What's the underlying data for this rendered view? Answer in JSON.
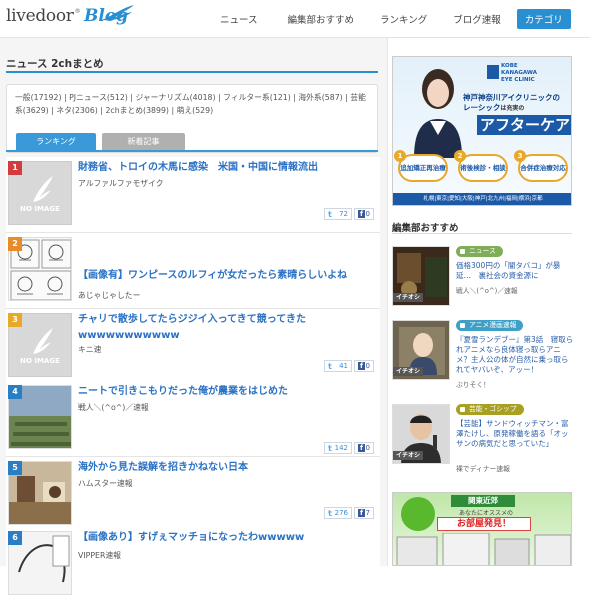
{
  "header": {
    "logo_text": "livedoor",
    "logo_reg": "®",
    "logo_blog": "Blog",
    "nav": [
      "ニュース",
      "編集部おすすめ",
      "ランキング",
      "ブログ速報"
    ],
    "category_button": "カテゴリ"
  },
  "main": {
    "section_title": "ニュース 2chまとめ",
    "categories": [
      "一般(17192)",
      "PJニュース(512)",
      "ジャーナリズム(4018)",
      "フィルター系(121)",
      "海外系(587)",
      "芸能系(3629)",
      "ネタ(2306)",
      "2chまとめ(3899)",
      "萌え(529)"
    ],
    "tabs": {
      "ranking": "ランキング",
      "latest": "新着記事"
    },
    "no_image": "NO IMAGE",
    "articles": [
      {
        "rank": "1",
        "title": "財務省、トロイの木馬に感染　米国・中国に情報流出",
        "blog": "アルファルファモザイク",
        "tweets": "72",
        "likes": "0"
      },
      {
        "rank": "2",
        "title": "【画像有】ワンピースのルフィが女だったら素晴らしいよね",
        "blog": "あじゃじゃしたー",
        "tweets": "33",
        "likes": "0"
      },
      {
        "rank": "3",
        "title": "チャリで散歩してたらジジイ入ってきて競ってきたwwwwwwwwwww",
        "blog": "キニ速",
        "tweets": "41",
        "likes": "0"
      },
      {
        "rank": "4",
        "title": "ニートで引きこもりだった俺が農業をはじめた",
        "blog": "戦人＼(^o^)／速報",
        "tweets": "142",
        "likes": "0"
      },
      {
        "rank": "5",
        "title": "海外から見た誤解を招きかねない日本",
        "blog": "ハムスター速報",
        "tweets": "276",
        "likes": "7"
      },
      {
        "rank": "6",
        "title": "【画像あり】すげぇマッチョになったわwwwww",
        "blog": "VIPPER速報",
        "tweets": "",
        "likes": ""
      }
    ]
  },
  "sidebar": {
    "ad": {
      "clinic_logo_line1": "KOBE",
      "clinic_logo_line2": "KANAGAWA",
      "clinic_logo_line3": "EYE CLINIC",
      "clinic_name": "神戸神奈川アイクリニックの",
      "clinic_sub_a": "レーシック",
      "clinic_sub_b": "は充実の",
      "aftercare": "アフターケア",
      "step1": "追加矯正再治療",
      "step2": "術後検診・相談",
      "step3": "合併症治療対応",
      "cities": "札幌|東京|愛知|大阪|神戸|北九州|福岡|横浜|京都"
    },
    "editor_title": "編集部おすすめ",
    "editor_items": [
      {
        "tag": "ニュース",
        "tag_color": "#7fae58",
        "title": "価格300円の「闇タバコ」が暴延…　裏社会の資金源に",
        "blog": "戦人＼(^o^)／速報",
        "brand": "イチオシ"
      },
      {
        "tag": "アニメ漫画速報",
        "tag_color": "#3fa0c7",
        "title": "『夏雪ランデブー』第3話　寝取られアニメなら良体寝っ取らアニメ？主人公の体が自然に乗っ取られてヤバいぞ、アッー！",
        "blog": "ぶりそく！",
        "brand": "イチオシ"
      },
      {
        "tag": "芸能・ゴシップ",
        "tag_color": "#a8a020",
        "title": "【芸能】サンドウィッチマン・富澤たけし、原発稼働を語る「オッサンの病気だと思っていた」",
        "blog": "裸でディナー速報",
        "brand": "イチオシ"
      }
    ],
    "ad2": {
      "t1": "関東近郊",
      "t2": "あなたにオススメの",
      "t3": "お部屋発見！"
    }
  }
}
